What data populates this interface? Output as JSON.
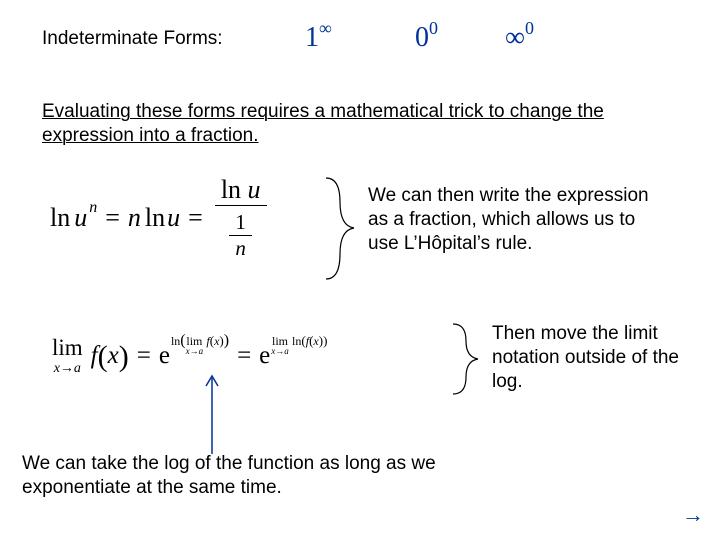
{
  "title": "Indeterminate Forms:",
  "forms": {
    "f1_base": "1",
    "f1_exp": "∞",
    "f2_base": "0",
    "f2_exp": "0",
    "f3_base": "∞",
    "f3_exp": "0"
  },
  "para1": "Evaluating these forms requires a mathematical trick to change the expression into a fraction.",
  "eq1": {
    "lhs_ln": "ln",
    "lhs_u": "u",
    "lhs_n": "n",
    "eq": "=",
    "mid_n": "n",
    "mid_ln": "ln",
    "mid_u": "u",
    "frac_num_ln": "ln",
    "frac_num_u": "u",
    "frac_den_top": "1",
    "frac_den_bot": "n"
  },
  "text1": "We can then write the expression as a fraction, which allows us to use L’Hôpital’s rule.",
  "eq2": {
    "lim": "lim",
    "lim_sub": "x→a",
    "f": "f",
    "x": "x",
    "eq": "=",
    "e": "e",
    "ln": "ln",
    "exp_lim": "lim",
    "exp_lim_sub": "x→a",
    "exp_f": "f",
    "exp_x": "x"
  },
  "text2": "Then move the limit notation outside of the log.",
  "para2": "We can take the log of the function as long as we exponentiate at the same time.",
  "slide_arrow": "→",
  "colors": {
    "math_blue": "#003399"
  }
}
